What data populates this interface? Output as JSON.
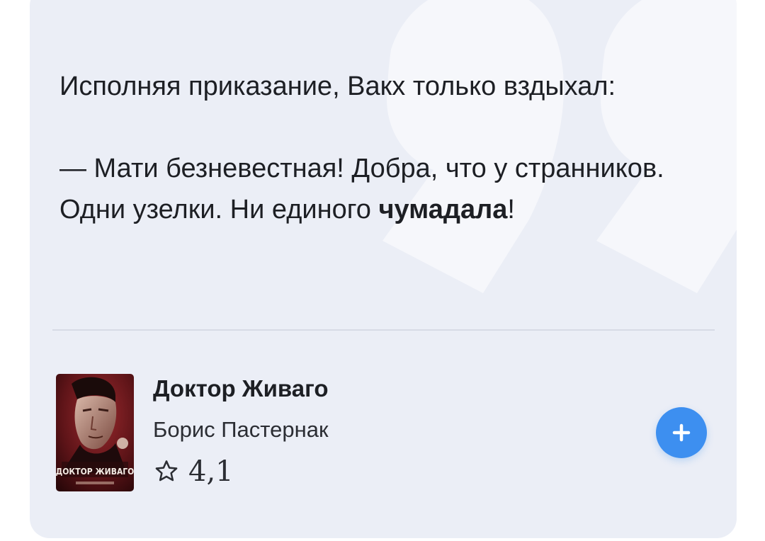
{
  "quote": {
    "line1": "Исполняя приказание, Вакх только вздыхал:",
    "line2": "— Мати безневестная! Добра, что у странников.",
    "line3_before": "Одни узелки. Ни единого ",
    "line3_bold": "чумадала",
    "line3_after": "!"
  },
  "book": {
    "title": "Доктор Живаго",
    "author": "Борис Пастернак",
    "rating": "4,1",
    "cover_text": "ДОКТОР ЖИВАГО"
  },
  "icons": {
    "rating": "star-outline-icon",
    "add": "plus-icon",
    "background": "quote-mark-icon"
  },
  "colors": {
    "card_background": "#ebeef6",
    "accent": "#3d8ff0",
    "text": "#1d1f24"
  }
}
